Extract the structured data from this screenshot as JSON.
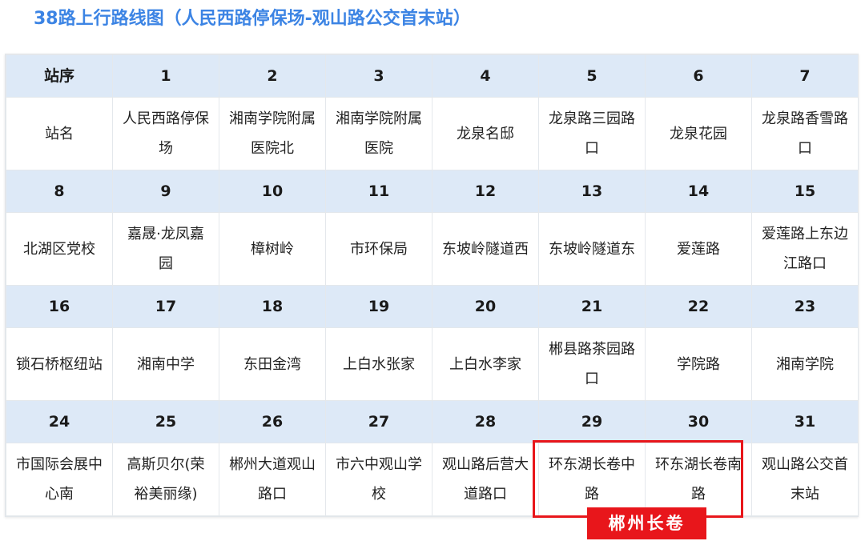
{
  "title": "38路上行路线图（人民西路停保场-观山路公交首末站）",
  "header": {
    "seq_label": "站序",
    "name_label": "站名"
  },
  "rows": [
    {
      "nums": [
        "1",
        "2",
        "3",
        "4",
        "5",
        "6",
        "7"
      ],
      "names": [
        "人民西路停保场",
        "湘南学院附属医院北",
        "湘南学院附属医院",
        "龙泉名邸",
        "龙泉路三园路口",
        "龙泉花园",
        "龙泉路香雪路口"
      ]
    },
    {
      "nums": [
        "8",
        "9",
        "10",
        "11",
        "12",
        "13",
        "14",
        "15"
      ],
      "names": [
        "北湖区党校",
        "嘉晟·龙凤嘉园",
        "樟树岭",
        "市环保局",
        "东坡岭隧道西",
        "东坡岭隧道东",
        "爱莲路",
        "爱莲路上东边江路口"
      ]
    },
    {
      "nums": [
        "16",
        "17",
        "18",
        "19",
        "20",
        "21",
        "22",
        "23"
      ],
      "names": [
        "锁石桥枢纽站",
        "湘南中学",
        "东田金湾",
        "上白水张家",
        "上白水李家",
        "郴县路茶园路口",
        "学院路",
        "湘南学院"
      ]
    },
    {
      "nums": [
        "24",
        "25",
        "26",
        "27",
        "28",
        "29",
        "30",
        "31"
      ],
      "names": [
        "市国际会展中心南",
        "高斯贝尔(荣裕美丽缘)",
        "郴州大道观山路口",
        "市六中观山学校",
        "观山路后营大道路口",
        "环东湖长卷中路",
        "环东湖长卷南路",
        "观山路公交首末站"
      ]
    }
  ],
  "annotation": {
    "label": "郴州长卷",
    "color": "#e8161b"
  },
  "colors": {
    "title": "#3c84e4",
    "header_bg": "#dde9f7"
  }
}
